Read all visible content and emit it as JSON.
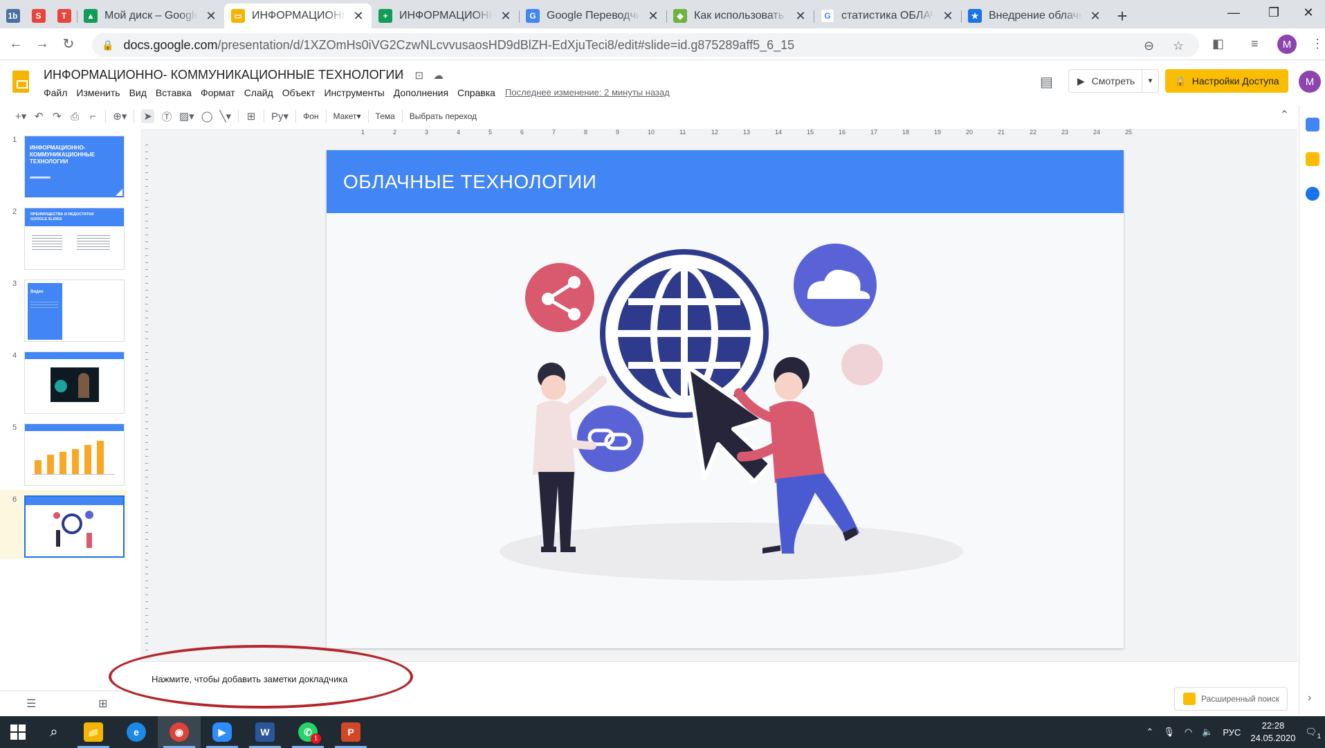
{
  "browser": {
    "tabs": [
      {
        "title": "Мой диск – Google",
        "favicon_color": "#0f9d58",
        "favicon_glyph": "▲"
      },
      {
        "title": "ИНФОРМАЦИОНН",
        "favicon_color": "#f4b400",
        "favicon_glyph": "▭"
      },
      {
        "title": "ИНФОРМАЦИОНН",
        "favicon_color": "#0f9d58",
        "favicon_glyph": "+"
      },
      {
        "title": "Google Переводчик",
        "favicon_color": "#4285f4",
        "favicon_glyph": "G"
      },
      {
        "title": "Как использовать С",
        "favicon_color": "#6db33f",
        "favicon_glyph": "◆"
      },
      {
        "title": "статистика ОБЛАЧН",
        "favicon_color": "#ffffff",
        "favicon_glyph": "G"
      },
      {
        "title": "Внедрение облачн",
        "favicon_color": "#1a73e8",
        "favicon_glyph": "★"
      }
    ],
    "pinned": [
      {
        "glyph": "1b",
        "color": "#4a6fa5"
      },
      {
        "glyph": "S",
        "color": "#e8453c"
      },
      {
        "glyph": "T",
        "color": "#e8453c"
      }
    ],
    "active_tab_index": 1,
    "url_host": "docs.google.com",
    "url_path": "/presentation/d/1XZOmHs0iVG2CzwNLcvvusaosHD9dBlZH-EdXjuTeci8/edit#slide=id.g875289aff5_6_15",
    "profile_initial": "M"
  },
  "app": {
    "doc_title": "ИНФОРМАЦИОННО- КОММУНИКАЦИОННЫЕ ТЕХНОЛОГИИ",
    "menu": [
      "Файл",
      "Изменить",
      "Вид",
      "Вставка",
      "Формат",
      "Слайд",
      "Объект",
      "Инструменты",
      "Дополнения",
      "Справка"
    ],
    "last_edit": "Последнее изменение: 2 минуты назад",
    "present_label": "Смотреть",
    "share_label": "Настройки Доступа",
    "avatar_initial": "M"
  },
  "edit_toolbar": {
    "background_label": "Фон",
    "layout_label": "Макет",
    "theme_label": "Тема",
    "transition_label": "Выбрать переход"
  },
  "ruler_ticks": [
    "1",
    "2",
    "3",
    "4",
    "5",
    "6",
    "7",
    "8",
    "9",
    "10",
    "11",
    "12",
    "13",
    "14",
    "15",
    "16",
    "17",
    "18",
    "19",
    "20",
    "21",
    "22",
    "23",
    "24",
    "25"
  ],
  "filmstrip": {
    "slides": [
      {
        "num": "1",
        "title": "ИНФОРМАЦИОННО-КОММУНИКАЦИОННЫЕ ТЕХНОЛОГИИ"
      },
      {
        "num": "2",
        "title": "ПРЕИМУЩЕСТВА И НЕДОСТАТКИ GOOGLE SLIDES"
      },
      {
        "num": "3",
        "title": "Видео"
      },
      {
        "num": "4",
        "title": ""
      },
      {
        "num": "5",
        "title": ""
      },
      {
        "num": "6",
        "title": ""
      }
    ],
    "selected_index": 5
  },
  "slide": {
    "title": "ОБЛАЧНЫЕ ТЕХНОЛОГИИ",
    "colors": {
      "header": "#4285f4",
      "globe": "#2e3b8c",
      "share_circle": "#d9596f",
      "cloud_circle": "#5a63d6",
      "link_circle": "#5a63d6",
      "pink_dot": "#f0d3d6"
    }
  },
  "notes": {
    "placeholder": "Нажмите, чтобы добавить заметки докладчика"
  },
  "explore": {
    "label": "Расширенный поиск"
  },
  "taskbar": {
    "apps": [
      {
        "name": "file-explorer",
        "glyph": "📁",
        "color": "#f4b400"
      },
      {
        "name": "edge",
        "glyph": "e",
        "color": "#1e88e5"
      },
      {
        "name": "chrome",
        "glyph": "◉",
        "color": "#db4437"
      },
      {
        "name": "zoom",
        "glyph": "▶",
        "color": "#2d8cff"
      },
      {
        "name": "word",
        "glyph": "W",
        "color": "#2b579a"
      },
      {
        "name": "whatsapp",
        "glyph": "✆",
        "color": "#25d366"
      },
      {
        "name": "powerpoint",
        "glyph": "P",
        "color": "#d24726"
      }
    ],
    "whatsapp_badge": "1",
    "lang": "РУС",
    "time": "22:28",
    "date": "24.05.2020",
    "notification_count": "1"
  }
}
